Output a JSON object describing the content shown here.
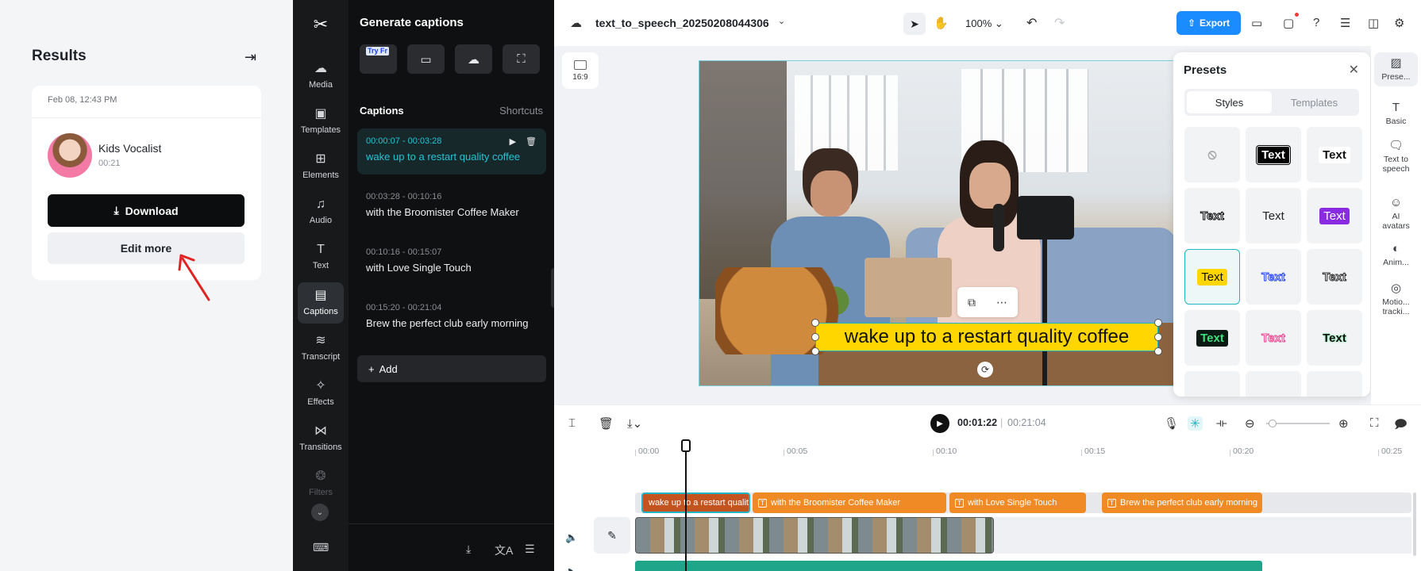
{
  "results": {
    "title": "Results",
    "date": "Feb 08, 12:43 PM",
    "voice_name": "Kids Vocalist",
    "duration": "00:21",
    "download_label": "Download",
    "edit_more_label": "Edit more"
  },
  "rail": {
    "items": [
      {
        "label": "Media",
        "icon": "media-icon"
      },
      {
        "label": "Templates",
        "icon": "templates-icon"
      },
      {
        "label": "Elements",
        "icon": "elements-icon"
      },
      {
        "label": "Audio",
        "icon": "audio-icon"
      },
      {
        "label": "Text",
        "icon": "text-icon"
      },
      {
        "label": "Captions",
        "icon": "captions-icon"
      },
      {
        "label": "Transcript",
        "icon": "transcript-icon"
      },
      {
        "label": "Effects",
        "icon": "effects-icon"
      },
      {
        "label": "Transitions",
        "icon": "transitions-icon"
      },
      {
        "label": "Filters",
        "icon": "filters-icon"
      }
    ],
    "active": "Captions"
  },
  "captions_panel": {
    "header": "Generate captions",
    "try_badge": "Try Fr",
    "section_title": "Captions",
    "shortcuts_label": "Shortcuts",
    "items": [
      {
        "time": "00:00:07 - 00:03:28",
        "text": "wake up to a restart quality coffee"
      },
      {
        "time": "00:03:28 - 00:10:16",
        "text": "with the Broomister Coffee Maker"
      },
      {
        "time": "00:10:16 - 00:15:07",
        "text": "with Love Single Touch"
      },
      {
        "time": "00:15:20 - 00:21:04",
        "text": "Brew the perfect club early morning"
      }
    ],
    "add_label": "Add"
  },
  "topbar": {
    "filename": "text_to_speech_20250208044306",
    "zoom": "100%",
    "export_label": "Export",
    "accent": "#1a8cff"
  },
  "canvas": {
    "ratio_label": "16:9",
    "caption_text": "wake up to a restart quality coffee"
  },
  "presets": {
    "title": "Presets",
    "tab_styles": "Styles",
    "tab_templates": "Templates",
    "tile_text": "Text"
  },
  "right_tools": [
    {
      "label": "Prese...",
      "icon": "presets-icon"
    },
    {
      "label": "Basic",
      "icon": "basic-icon"
    },
    {
      "label": "Text to speech",
      "icon": "text-to-speech-icon"
    },
    {
      "label": "AI avatars",
      "icon": "ai-avatars-icon"
    },
    {
      "label": "Anim...",
      "icon": "animation-icon"
    },
    {
      "label": "Motio... tracki...",
      "icon": "motion-tracking-icon"
    }
  ],
  "timeline": {
    "current_time": "00:01:22",
    "total_time": "00:21:04",
    "ticks": [
      "00:00",
      "00:05",
      "00:10",
      "00:15",
      "00:20",
      "00:25"
    ],
    "clips": [
      "wake up to a restart quality coffee",
      "with the Broomister Coffee Maker",
      "with Love Single Touch",
      "Brew the perfect club early morning"
    ]
  }
}
